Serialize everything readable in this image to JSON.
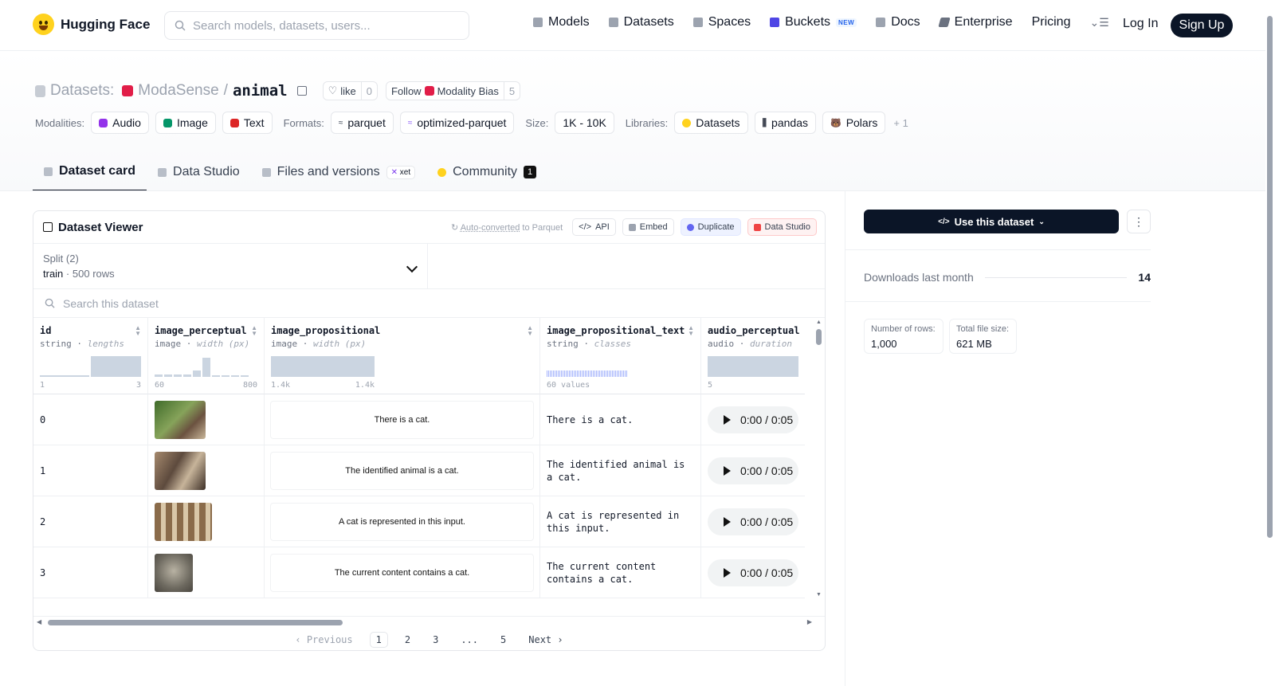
{
  "header": {
    "brand": "Hugging Face",
    "search_placeholder": "Search models, datasets, users...",
    "nav": [
      {
        "label": "Models",
        "icon": "cube-icon",
        "color": "#9ca3af"
      },
      {
        "label": "Datasets",
        "icon": "database-icon",
        "color": "#9ca3af"
      },
      {
        "label": "Spaces",
        "icon": "grid-icon",
        "color": "#9ca3af"
      },
      {
        "label": "Buckets",
        "icon": "bucket-icon",
        "color": "#4f46e5",
        "badge": "NEW"
      },
      {
        "label": "Docs",
        "icon": "book-icon",
        "color": "#9ca3af"
      },
      {
        "label": "Enterprise",
        "icon": "enterprise-icon",
        "color": "#6b7280"
      },
      {
        "label": "Pricing"
      }
    ],
    "login": "Log In",
    "signup": "Sign Up"
  },
  "repo": {
    "type_label": "Datasets:",
    "org": "ModaSense",
    "separator": "/",
    "name": "animal",
    "like_label": "like",
    "like_count": "0",
    "follow_label": "Follow",
    "follow_org": "Modality Bias",
    "follow_count": "5"
  },
  "meta": {
    "modalities_label": "Modalities:",
    "modalities": [
      {
        "label": "Audio",
        "color": "#9333ea"
      },
      {
        "label": "Image",
        "color": "#059669"
      },
      {
        "label": "Text",
        "color": "#dc2626"
      }
    ],
    "formats_label": "Formats:",
    "formats": [
      "parquet",
      "optimized-parquet"
    ],
    "size_label": "Size:",
    "size": "1K - 10K",
    "libraries_label": "Libraries:",
    "libraries": [
      "Datasets",
      "pandas",
      "Polars"
    ],
    "libraries_more": "+ 1"
  },
  "tabs": [
    {
      "label": "Dataset card",
      "active": true
    },
    {
      "label": "Data Studio"
    },
    {
      "label": "Files and versions",
      "badge": "xet"
    },
    {
      "label": "Community",
      "count": "1"
    }
  ],
  "viewer": {
    "title": "Dataset Viewer",
    "auto_converted": "Auto-converted",
    "auto_suffix": "to Parquet",
    "actions": [
      "API",
      "Embed",
      "Duplicate",
      "Data Studio"
    ],
    "split_label": "Split (2)",
    "split_value": "train",
    "split_rows": "500 rows",
    "search_placeholder": "Search this dataset",
    "columns": [
      {
        "name": "id",
        "type": "string",
        "stat": "lengths",
        "min": "1",
        "max": "3"
      },
      {
        "name": "image_perceptual",
        "type": "image",
        "stat": "width (px)",
        "min": "60",
        "max": "800"
      },
      {
        "name": "image_propositional",
        "type": "image",
        "stat": "width (px)",
        "min": "1.4k",
        "max": "1.4k"
      },
      {
        "name": "image_propositional_text",
        "type": "string",
        "stat": "classes",
        "min": "60 values",
        "max": ""
      },
      {
        "name": "audio_perceptual",
        "type": "audio",
        "stat": "duration",
        "min": "5",
        "max": ""
      }
    ],
    "rows": [
      {
        "id": "0",
        "prop_image_text": "There is a cat.",
        "prop_text": "There is a cat.",
        "audio": "0:00 / 0:05"
      },
      {
        "id": "1",
        "prop_image_text": "The identified animal is a cat.",
        "prop_text": "The identified animal is a cat.",
        "audio": "0:00 / 0:05"
      },
      {
        "id": "2",
        "prop_image_text": "A cat is represented in this input.",
        "prop_text": "A cat is represented in this input.",
        "audio": "0:00 / 0:05"
      },
      {
        "id": "3",
        "prop_image_text": "The current content contains a cat.",
        "prop_text": "The current content contains a cat.",
        "audio": "0:00 / 0:05"
      }
    ],
    "pager": {
      "prev": "Previous",
      "pages": [
        "1",
        "2",
        "3",
        "...",
        "5"
      ],
      "current": "1",
      "next": "Next"
    }
  },
  "sidebar": {
    "use_button": "Use this dataset",
    "downloads_label": "Downloads last month",
    "downloads_value": "14",
    "rows_label": "Number of rows:",
    "rows_value": "1,000",
    "size_label": "Total file size:",
    "size_value": "621 MB"
  }
}
